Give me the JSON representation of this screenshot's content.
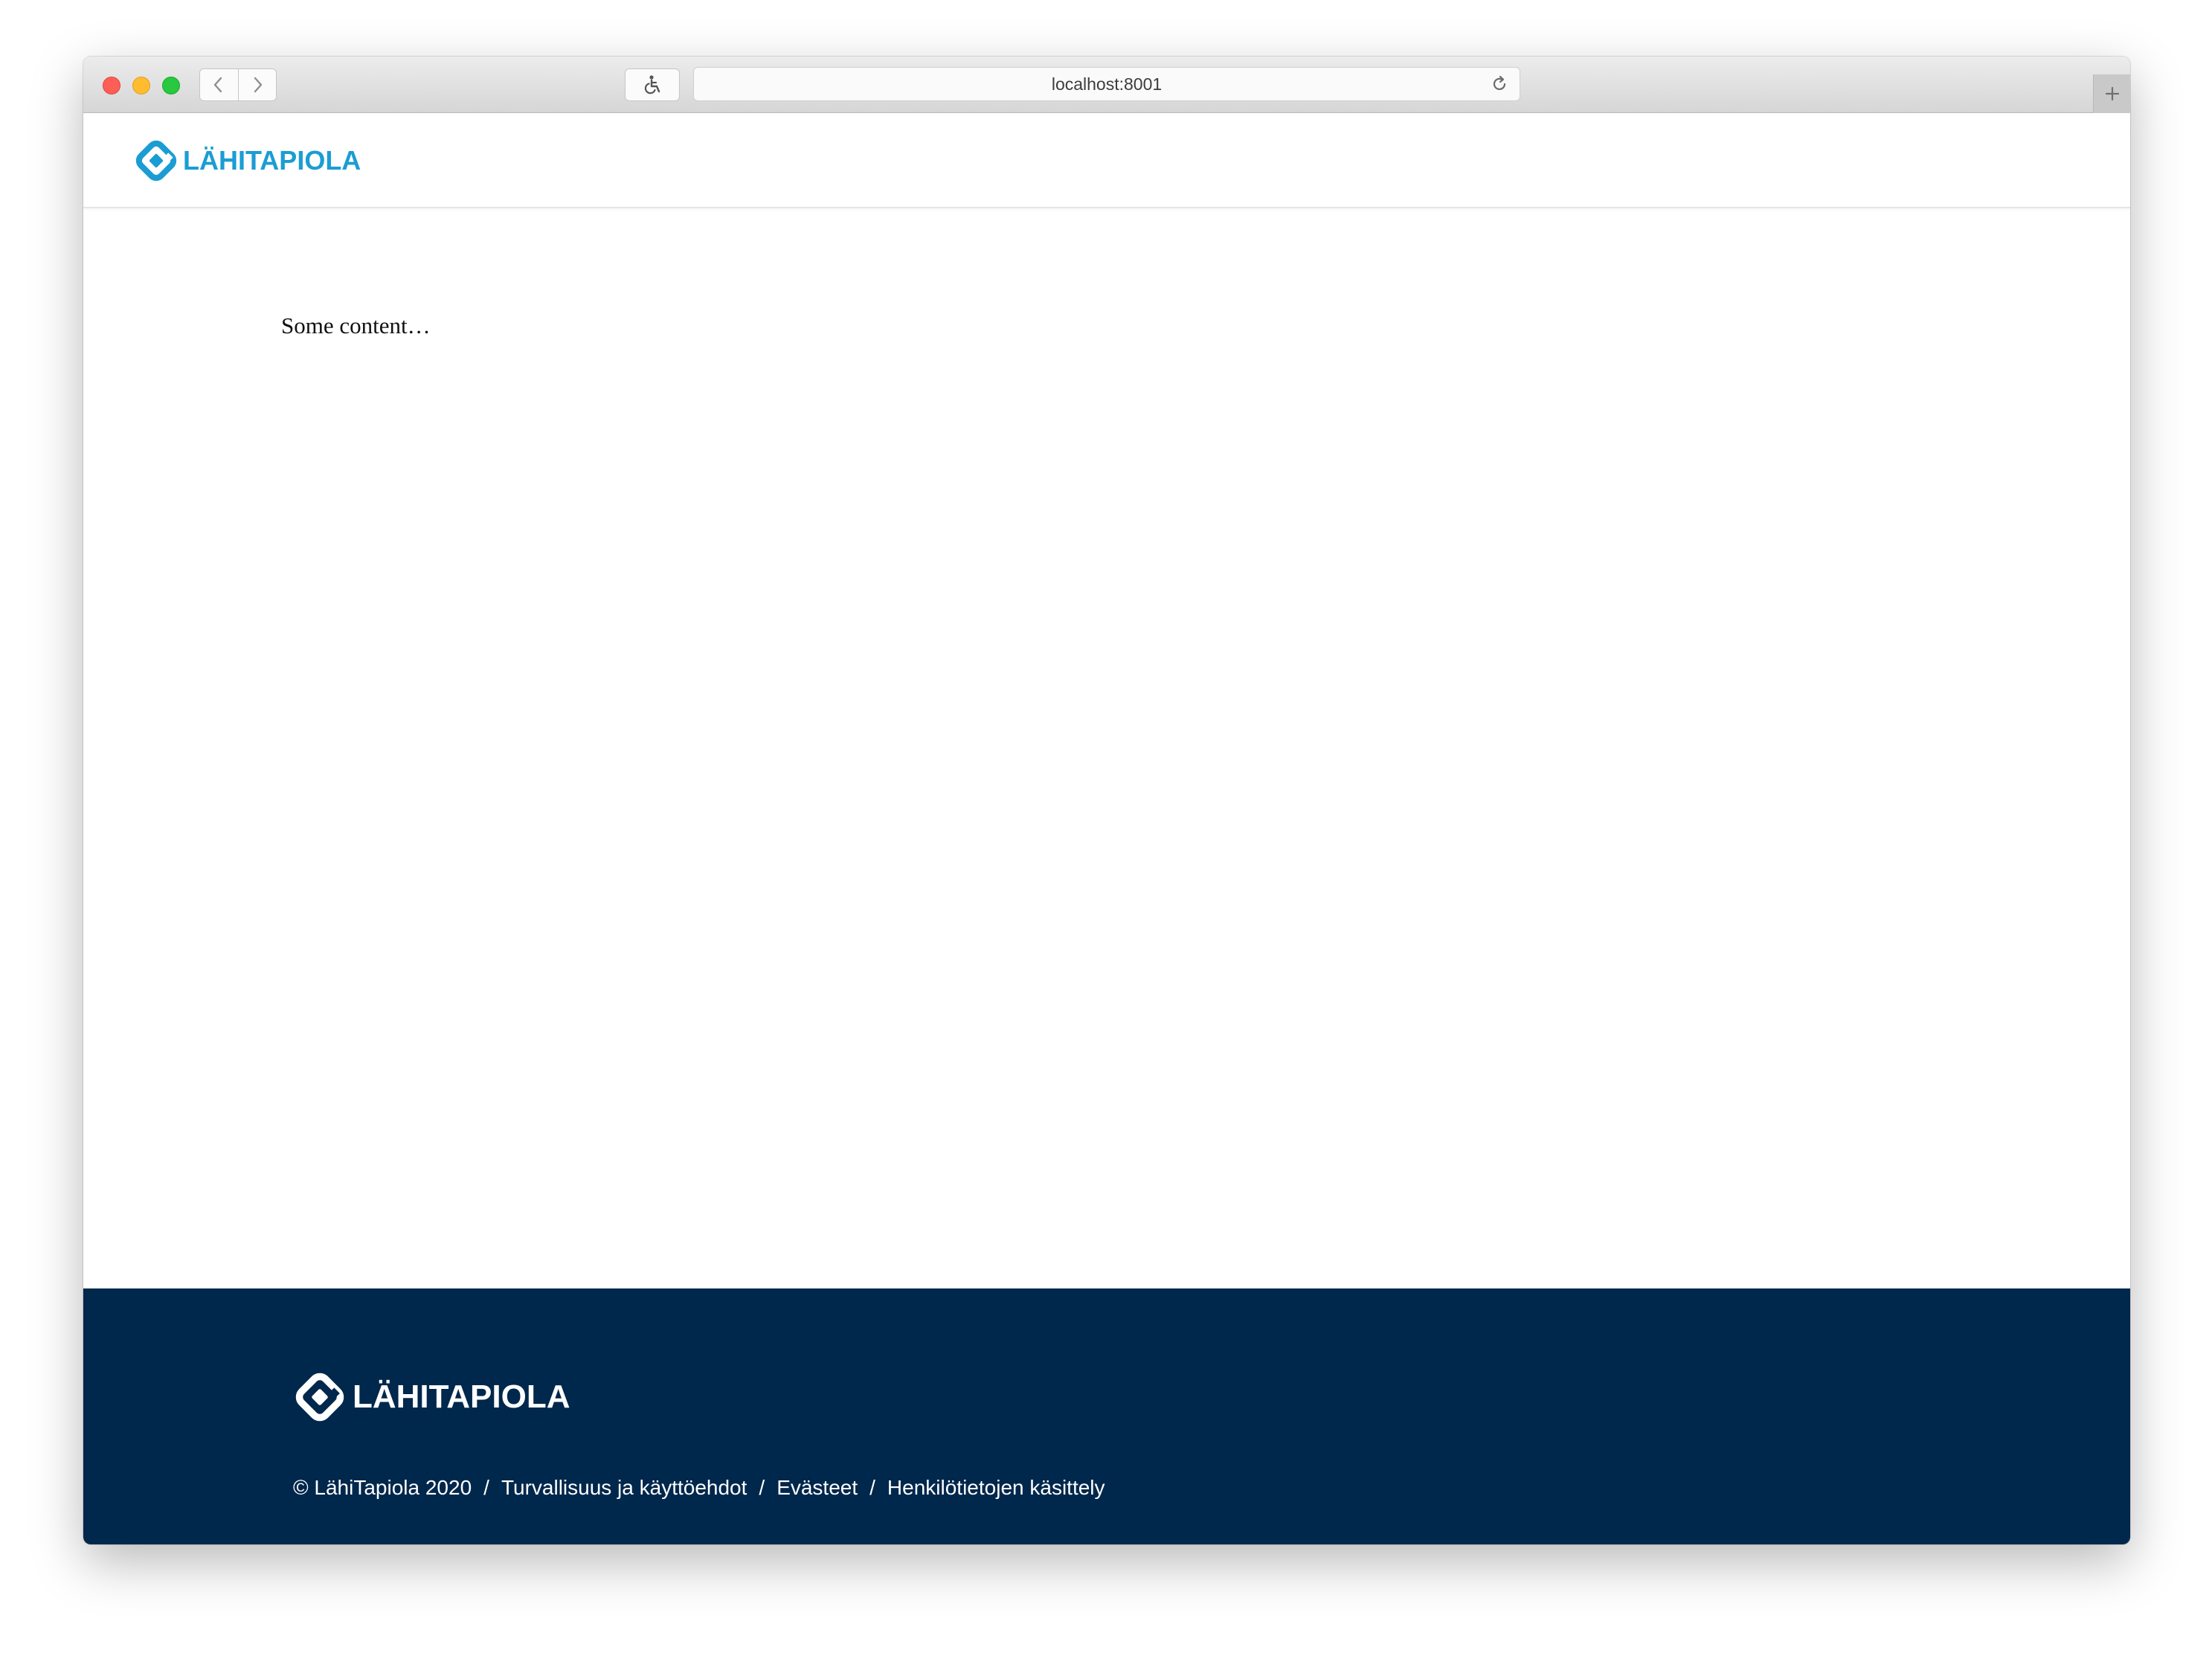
{
  "browser": {
    "url": "localhost:8001",
    "icons": {
      "back": "chevron-left-icon",
      "forward": "chevron-right-icon",
      "accessibility": "wheelchair-icon",
      "reload": "reload-icon",
      "new_tab": "plus-icon"
    }
  },
  "header": {
    "logo_text": "LÄHITAPIOLA"
  },
  "main": {
    "content": "Some content…"
  },
  "footer": {
    "logo_text": "LÄHITAPIOLA",
    "copyright": "© LähiTapiola 2020",
    "separator": "/",
    "links": [
      {
        "label": "Turvallisuus ja käyttöehdot"
      },
      {
        "label": "Evästeet"
      },
      {
        "label": "Henkilötietojen käsittely"
      }
    ]
  },
  "colors": {
    "brand_blue": "#1b9dd3",
    "footer_navy": "#00274c",
    "white": "#ffffff"
  }
}
